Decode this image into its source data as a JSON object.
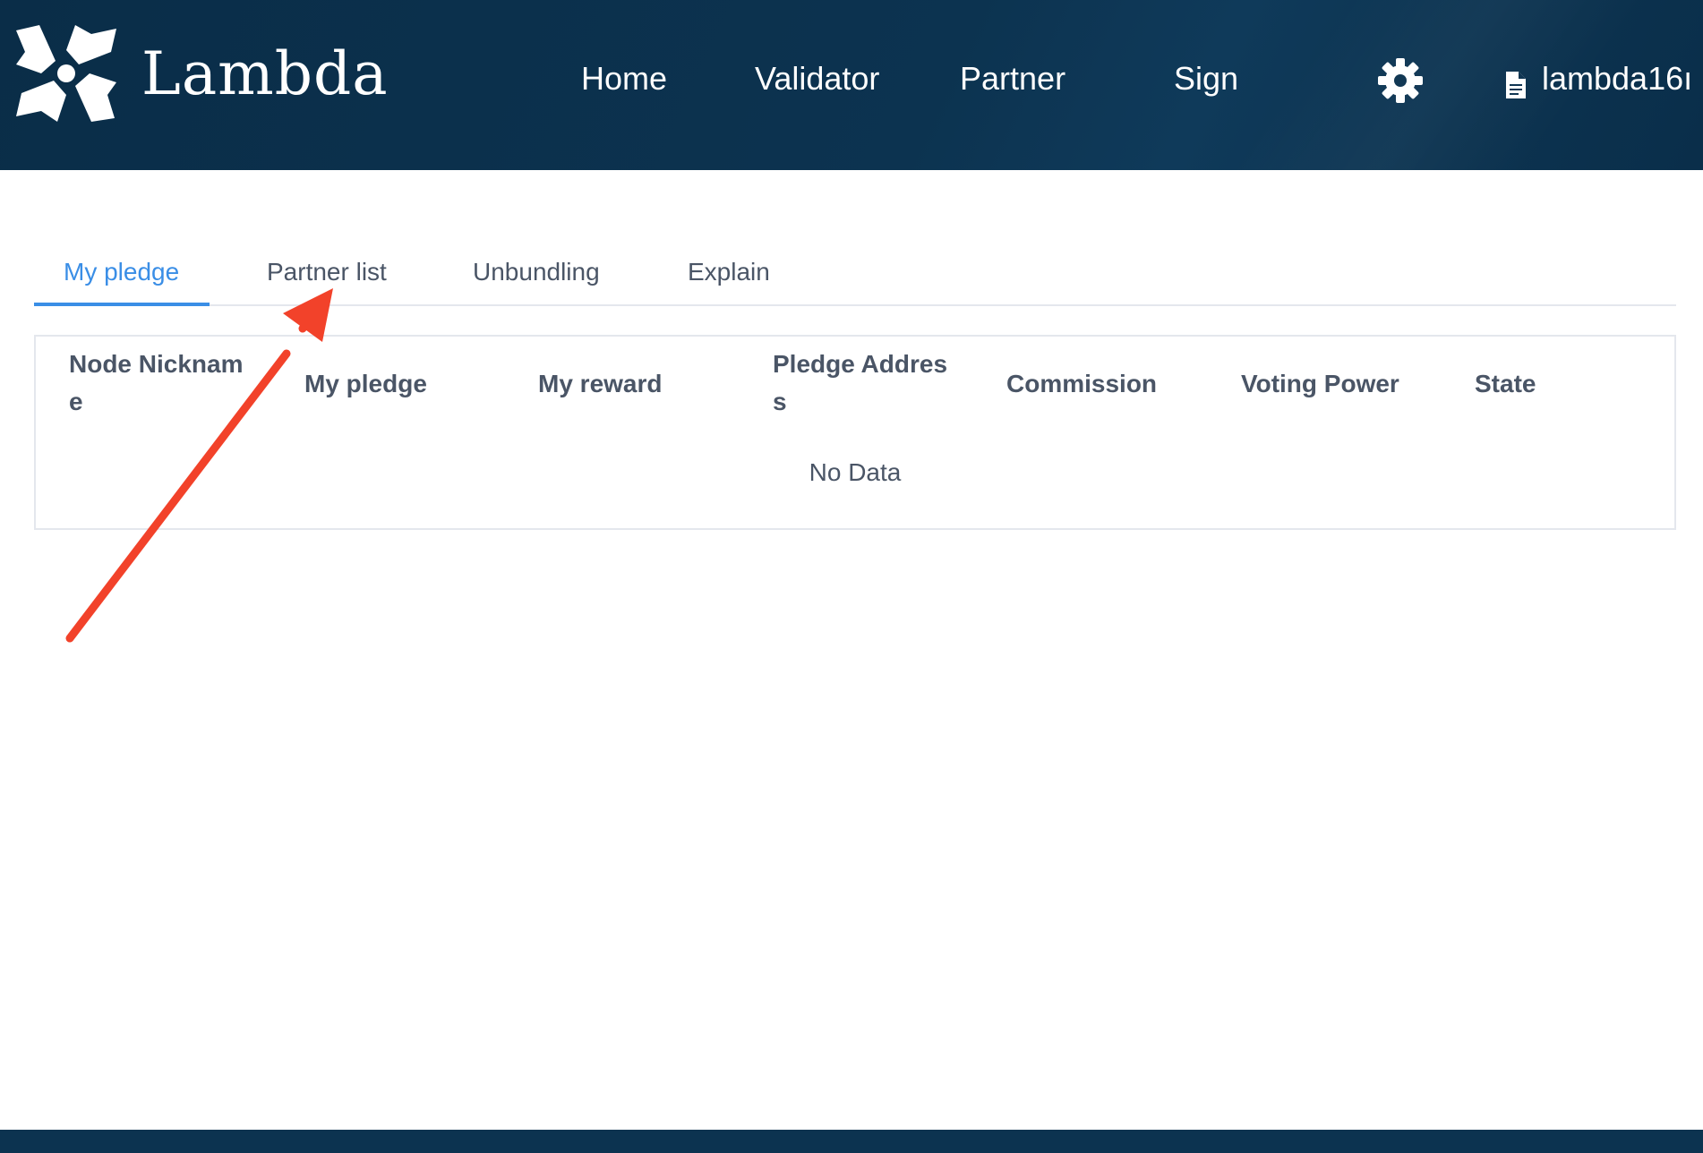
{
  "header": {
    "logo_text": "Lambda",
    "nav": [
      {
        "label": "Home"
      },
      {
        "label": "Validator"
      },
      {
        "label": "Partner"
      },
      {
        "label": "Sign"
      }
    ],
    "settings_icon": "gear-icon",
    "account_icon": "document-icon",
    "account_label": "lambda16ı"
  },
  "tabs": [
    {
      "label": "My pledge",
      "active": true
    },
    {
      "label": "Partner list",
      "active": false
    },
    {
      "label": "Unbundling",
      "active": false
    },
    {
      "label": "Explain",
      "active": false
    }
  ],
  "table": {
    "columns": [
      "Node Nickname",
      "My pledge",
      "My reward",
      "Pledge Address",
      "Commission",
      "Voting Power",
      "State"
    ],
    "empty_text": "No Data"
  },
  "colors": {
    "header_bg": "#0c3350",
    "accent": "#3a8ee6",
    "text": "#4a5566",
    "annotation_arrow": "#f2422a"
  }
}
